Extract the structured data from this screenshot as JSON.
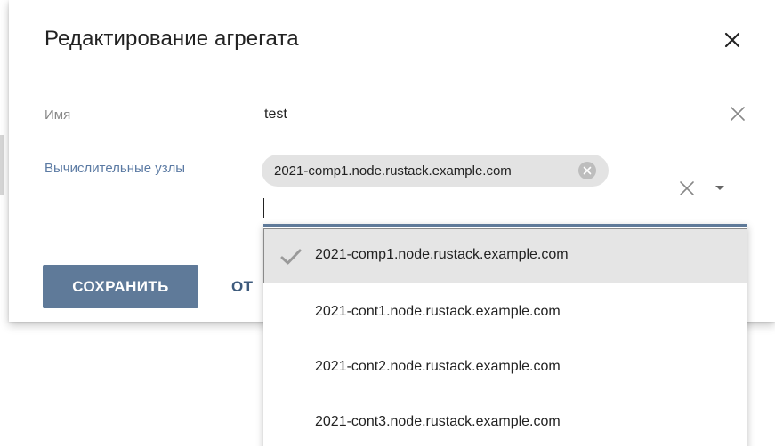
{
  "dialog": {
    "title": "Редактирование агрегата"
  },
  "form": {
    "name": {
      "label": "Имя",
      "value": "test"
    },
    "nodes": {
      "label": "Вычислительные узлы",
      "selected": [
        "2021-comp1.node.rustack.example.com"
      ]
    }
  },
  "actions": {
    "save_label": "СОХРАНИТЬ",
    "cancel_label_visible": "ОТ"
  },
  "dropdown": {
    "options": [
      {
        "label": "2021-comp1.node.rustack.example.com",
        "selected": true
      },
      {
        "label": "2021-cont1.node.rustack.example.com",
        "selected": false
      },
      {
        "label": "2021-cont2.node.rustack.example.com",
        "selected": false
      },
      {
        "label": "2021-cont3.node.rustack.example.com",
        "selected": false
      }
    ]
  },
  "icons": {
    "close": "close-icon",
    "clear": "clear-icon",
    "chip_remove": "chip-remove-icon",
    "caret": "caret-down-icon",
    "check": "check-icon"
  },
  "colors": {
    "primary": "#5f7a99",
    "label_accent": "#5b7aa3",
    "chip_bg": "#e3e3e3",
    "selected_option_bg": "#e5e5e5"
  }
}
